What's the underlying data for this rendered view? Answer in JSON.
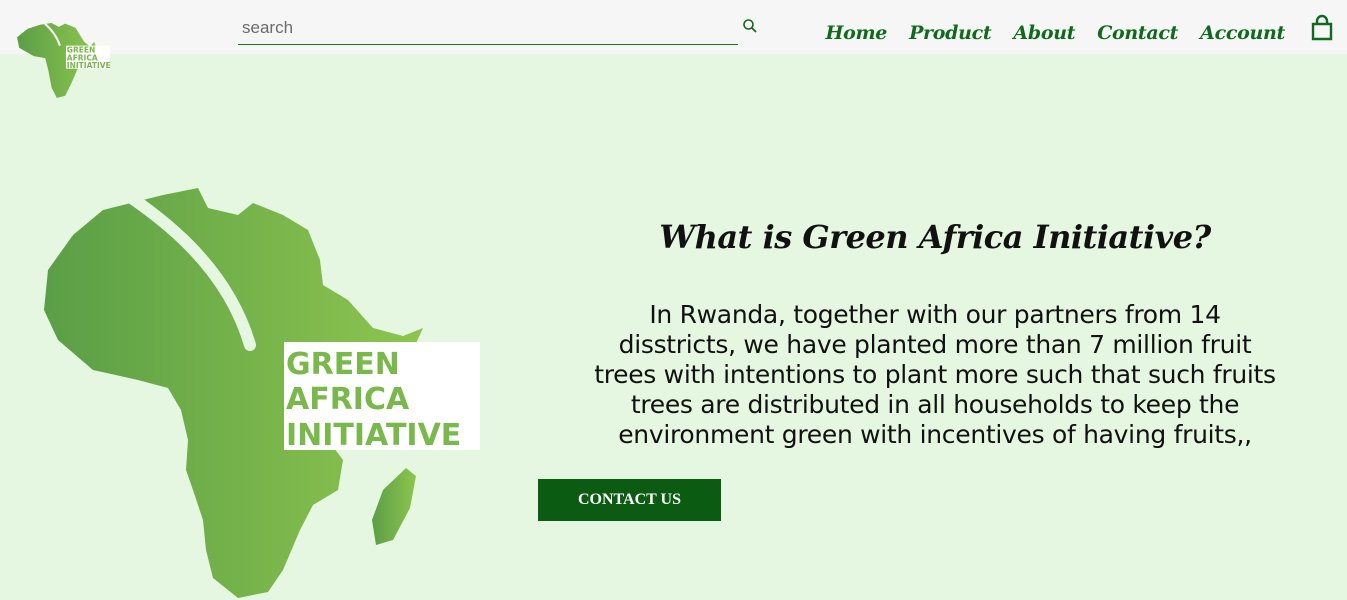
{
  "header": {
    "logo_text": [
      "GREEN",
      "AFRICA",
      "INITIATIVE"
    ],
    "search": {
      "placeholder": "search",
      "value": ""
    },
    "nav": [
      "Home",
      "Product",
      "About",
      "Contact",
      "Account"
    ],
    "icons": {
      "search": "search-icon",
      "cart": "shopping-bag-icon"
    }
  },
  "hero": {
    "logo_text": [
      "GREEN",
      "AFRICA",
      "INITIATIVE"
    ],
    "title": "What is Green Africa Initiative?",
    "lines": [
      "In Rwanda, together with our partners from 14",
      "disstricts, we have planted more than 7 million fruit",
      "trees with intentions to plant more such that such fruits",
      "trees are distributed in all households to keep the",
      "environment green with incentives of having fruits,,"
    ],
    "cta_label": "CONTACT US"
  },
  "colors": {
    "background": "#e5f7e1",
    "header": "#f6f6f6",
    "nav": "#0f6b1b",
    "button": "#0b5c12",
    "map_dark": "#5a9e46",
    "map_light": "#8ec54f"
  }
}
